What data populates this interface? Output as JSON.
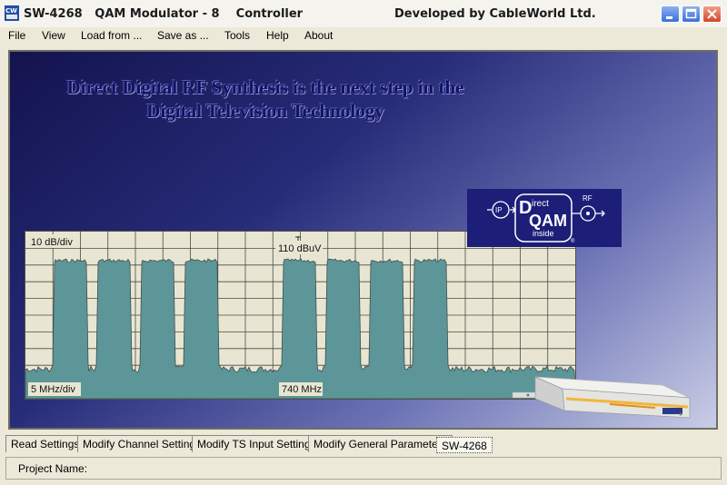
{
  "window": {
    "title_left": "SW-4268   QAM Modulator - 8    Controller",
    "title_right": "Developed by CableWorld Ltd.",
    "icon_letters": "CW"
  },
  "menu": [
    {
      "label": "File",
      "hotkey": "F"
    },
    {
      "label": "View",
      "hotkey": "V"
    },
    {
      "label": "Load from ...",
      "hotkey": "L"
    },
    {
      "label": "Save as ...",
      "hotkey": "S"
    },
    {
      "label": "Tools",
      "hotkey": "T"
    },
    {
      "label": "Help",
      "hotkey": "H"
    },
    {
      "label": "About",
      "hotkey": "A"
    }
  ],
  "headline": {
    "line1": "Direct Digital RF Synthesis is the next step in the",
    "line2": "Digital Television Technology"
  },
  "spectrum": {
    "ref_level": "10 dB/div",
    "marker_level": "110 dBuV",
    "span": "5 MHz/div",
    "center": "740 MHz",
    "channel_count": 8
  },
  "logo": {
    "ip": "IP",
    "rf": "RF",
    "d": "D",
    "irect": "irect",
    "qam": "QAM",
    "inside": "inside",
    "reg": "®"
  },
  "tabs": [
    {
      "label": "Read Settings",
      "active": false
    },
    {
      "label": "Modify Channel Settings",
      "active": false
    },
    {
      "label": "Modify TS Input Settings",
      "active": false
    },
    {
      "label": "Modify General Parameters",
      "active": false
    },
    {
      "label": "SW-4268",
      "active": true
    }
  ],
  "status": {
    "project_label": "Project Name:"
  },
  "colors": {
    "spectrum_fill": "#5d9698",
    "spectrum_bg": "#e8e6d2",
    "headline": "#10116a",
    "logo_bg": "#1c1e78"
  }
}
